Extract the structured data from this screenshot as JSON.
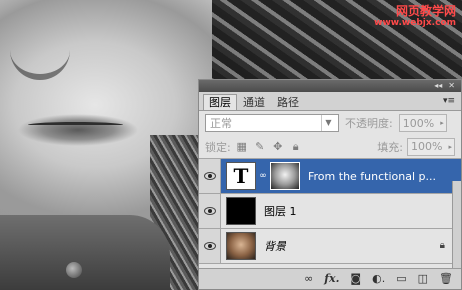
{
  "watermark": {
    "line1": "网页教学网",
    "line2": "www.webjx.com"
  },
  "panel": {
    "collapse_glyph": "◂◂",
    "close_glyph": "✕",
    "menu_glyph": "▾≡",
    "tabs": [
      {
        "label": "图层",
        "active": true
      },
      {
        "label": "通道",
        "active": false
      },
      {
        "label": "路径",
        "active": false
      }
    ],
    "blend_mode": "正常",
    "opacity_label": "不透明度:",
    "opacity_value": "100%",
    "lock_label": "锁定:",
    "fill_label": "填充:",
    "fill_value": "100%",
    "layers": [
      {
        "name": "From the functional p...",
        "thumb": "T",
        "type": "text",
        "selected": true,
        "linked_mask": true,
        "italic": false,
        "locked": false
      },
      {
        "name": "图层 1",
        "thumb": "",
        "type": "black",
        "selected": false,
        "linked_mask": false,
        "italic": false,
        "locked": false
      },
      {
        "name": "背景",
        "thumb": "",
        "type": "photo",
        "selected": false,
        "linked_mask": false,
        "italic": true,
        "locked": true
      }
    ],
    "bottom_buttons": [
      {
        "icon": "link-icon",
        "glyph": "∞"
      },
      {
        "icon": "fx-icon",
        "glyph": "fx."
      },
      {
        "icon": "add-mask-icon",
        "glyph": "◙"
      },
      {
        "icon": "adjustment-layer-icon",
        "glyph": "◐."
      },
      {
        "icon": "new-group-icon",
        "glyph": "▭"
      },
      {
        "icon": "new-layer-icon",
        "glyph": "◫"
      },
      {
        "icon": "trash-icon",
        "glyph": "🗑"
      }
    ]
  },
  "colors": {
    "selection": "#3565ac",
    "watermark": "#ff4a4a"
  }
}
